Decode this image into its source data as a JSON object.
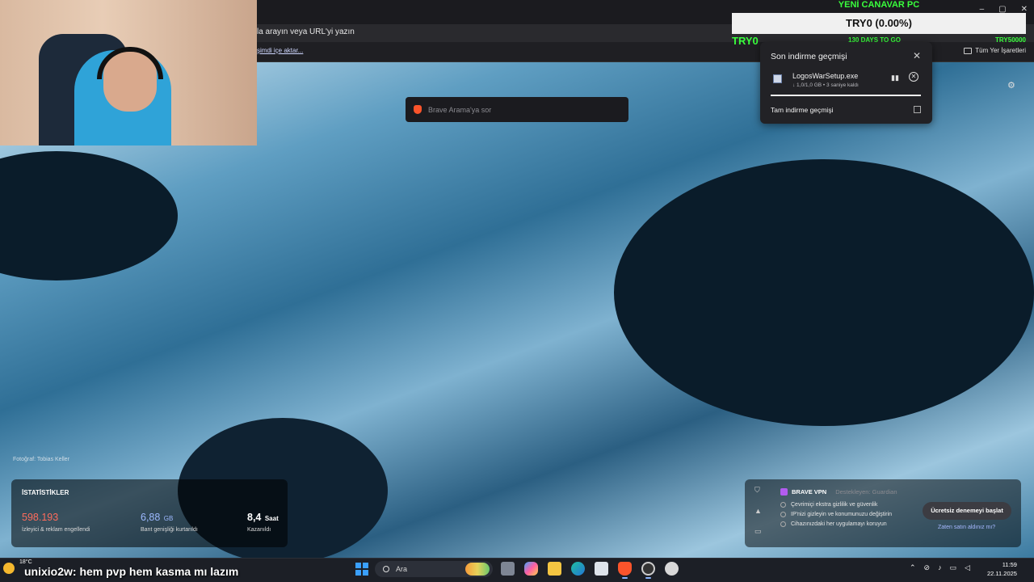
{
  "browser": {
    "address_placeholder": "la arayın veya URL'yi yazın",
    "import_link": "şimdi içe aktar...",
    "all_bookmarks": "Tüm Yer İşaretleri"
  },
  "overlay": {
    "header": "YENİ CANAVAR PC",
    "bar_text": "TRY0 (0.00%)",
    "left_tag": "TRY0",
    "mid_tag": "130 DAYS TO GO",
    "right_tag": "TRY50000"
  },
  "search": {
    "placeholder": "Brave Arama'ya sor"
  },
  "download": {
    "title": "Son indirme geçmişi",
    "file_name": "LogosWarSetup.exe",
    "file_status": "↓ 1,0/1,0 GB • 3 saniye kaldı",
    "progress_percent": 100,
    "history_link": "Tam indirme geçmişi"
  },
  "photo_credit": "Fotoğraf: Tobias Keller",
  "stats": {
    "heading": "İSTATİSTİKLER",
    "items": [
      {
        "value": "598.193",
        "unit": "",
        "label": "İzleyici & reklam engellendi"
      },
      {
        "value": "6,88",
        "unit": "GB",
        "label": "Bant genişliği kurtarıldı"
      },
      {
        "value": "8,4",
        "unit": "Saat",
        "label": "Kazanıldı"
      }
    ]
  },
  "vpn": {
    "name": "BRAVE VPN",
    "sponsor": "Destekleyen: Guardian",
    "features": [
      "Çevrimiçi ekstra gizlilik ve güvenlik",
      "IP'nizi gizleyin ve konumunuzu değiştirin",
      "Cihazınızdaki her uygulamayı koruyun"
    ],
    "cta": "Ücretsiz denemeyi başlat",
    "restore": "Zaten satın aldınız mı?"
  },
  "chat": {
    "line": "unixio2w: hem pvp hem kasma mı lazım"
  },
  "taskbar": {
    "weather_temp": "18°C",
    "search_placeholder": "Ara",
    "time": "11:59",
    "date": "22.11.2025"
  }
}
